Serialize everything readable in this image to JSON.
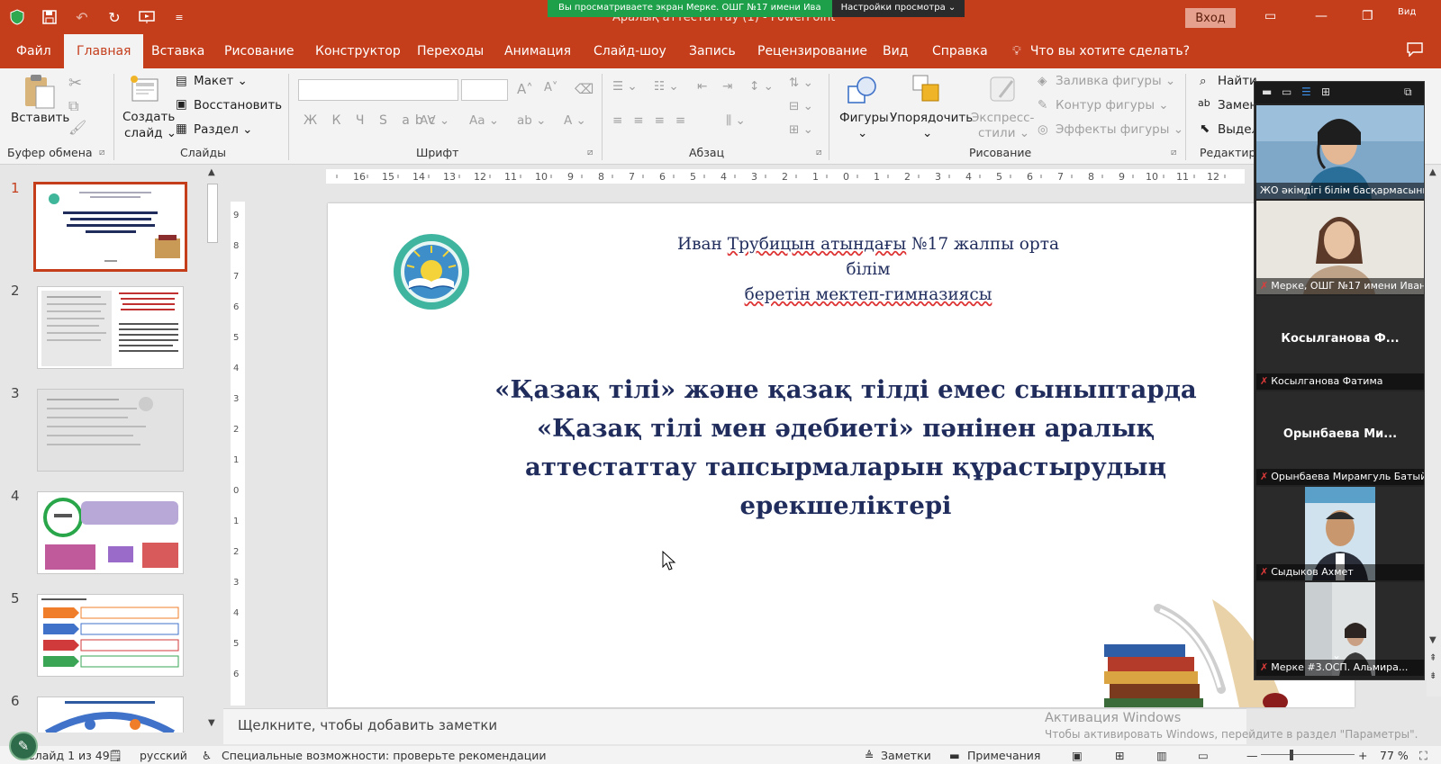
{
  "titlebar": {
    "doc_title": "Аралық аттестаттау (1)  -  PowerPoint",
    "share_message": "Вы просматриваете экран Мерке. ОШГ №17 имени Ива",
    "share_settings": "Настройки просмотра",
    "login": "Вход",
    "corner_label": "Вид"
  },
  "tabs": {
    "file": "Файл",
    "home": "Главная",
    "insert": "Вставка",
    "draw": "Рисование",
    "design": "Конструктор",
    "transitions": "Переходы",
    "animation": "Анимация",
    "slideshow": "Слайд-шоу",
    "record": "Запись",
    "review": "Рецензирование",
    "view": "Вид",
    "help": "Справка",
    "tell_me": "Что вы хотите сделать?"
  },
  "ribbon": {
    "clipboard": {
      "paste": "Вставить",
      "label": "Буфер обмена"
    },
    "slides": {
      "new_slide": "Создать",
      "new_slide2": "слайд",
      "layout": "Макет",
      "reset": "Восстановить",
      "section": "Раздел",
      "label": "Слайды"
    },
    "font": {
      "label": "Шрифт",
      "format_buttons": "Ж К Ч S abc"
    },
    "paragraph": {
      "label": "Абзац"
    },
    "drawing": {
      "shapes": "Фигуры",
      "arrange": "Упорядочить",
      "quick_styles": "Экспресс-",
      "quick_styles2": "стили",
      "fill": "Заливка фигуры",
      "outline": "Контур фигуры",
      "effects": "Эффекты фигуры",
      "label": "Рисование"
    },
    "editing": {
      "find": "Найти",
      "replace": "Замен",
      "select": "Выдел",
      "label": "Редактир"
    }
  },
  "thumbnails": [
    "1",
    "2",
    "3",
    "4",
    "5",
    "6"
  ],
  "slide": {
    "school_line1_pre": "Иван ",
    "school_line1_u": "Трубицын атындағы",
    "school_line1_post": " №17 жалпы орта білім",
    "school_line2": "беретін мектеп-гимназиясы",
    "title_line1": "«Қазақ тілі» және қазақ тілді емес сыныптарда",
    "title_line2": "«Қазақ тілі мен әдебиеті» пәнінен аралық",
    "title_line3": "аттестаттау тапсырмаларын құрастырудың",
    "title_line4": "ерекшеліктері"
  },
  "notes": {
    "placeholder": "Щелкните, чтобы добавить заметки",
    "activation_title": "Активация Windows",
    "activation_text": "Чтобы активировать Windows, перейдите в раздел \"Параметры\"."
  },
  "status": {
    "slide_count": "Слайд 1 из 49",
    "language": "русский",
    "accessibility": "Специальные возможности: проверьте рекомендации",
    "notes_btn": "Заметки",
    "comments_btn": "Примечания",
    "zoom": "77 %"
  },
  "participants": [
    {
      "name": "ЖО әкімдігі білім басқармасының ..."
    },
    {
      "name": "Мерке, ОШГ №17 имени Иван..."
    },
    {
      "big": "Косылганова  Ф...",
      "name": "Косылганова Фатима"
    },
    {
      "big": "Орынбаева  Ми...",
      "name": "Орынбаева Мирамгуль Батыйх..."
    },
    {
      "name": "Сыдыков Ахмет"
    },
    {
      "name": "Мерке #3.ОСП. Альмира..."
    }
  ],
  "colors": {
    "accent": "#c43e1c",
    "slide_text": "#1f2c5c",
    "share_green": "#1ea04a"
  }
}
